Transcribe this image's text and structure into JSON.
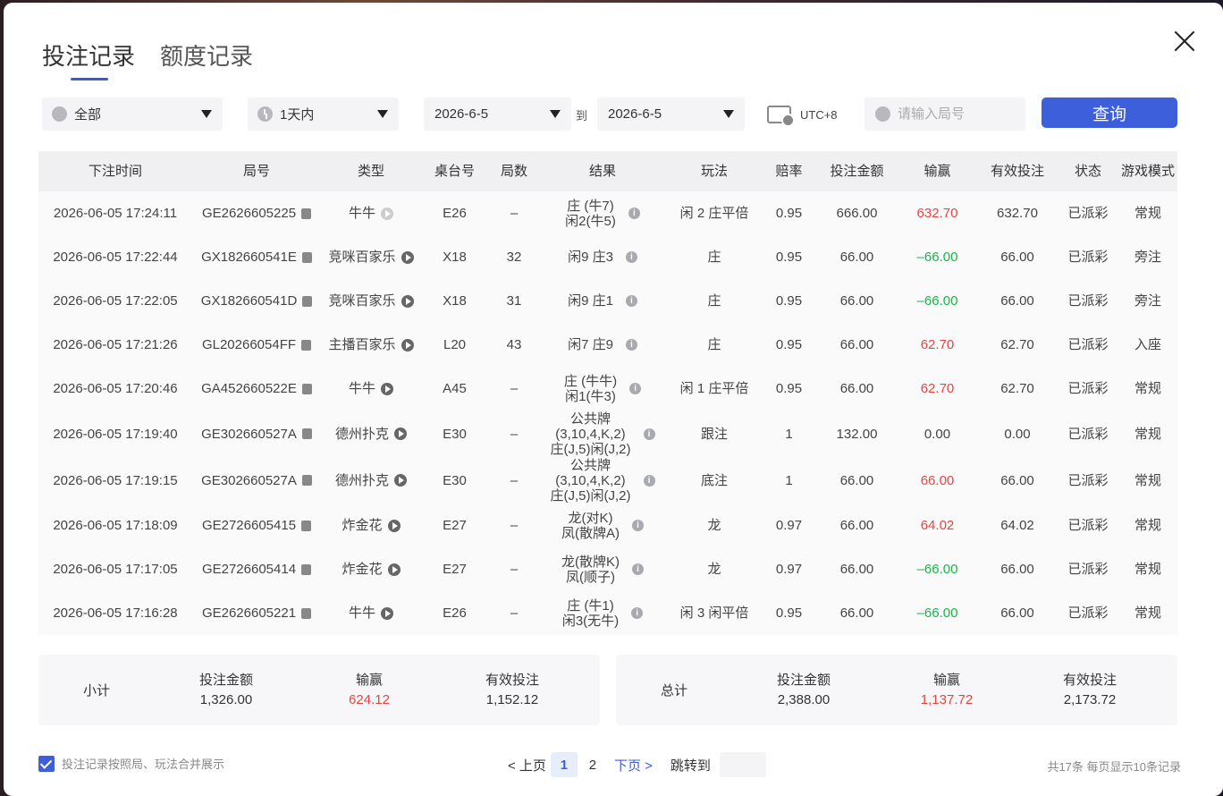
{
  "tabs": [
    {
      "label": "投注记录",
      "active": true
    },
    {
      "label": "额度记录",
      "active": false
    }
  ],
  "filters": {
    "category": "全部",
    "period": "1天内",
    "date_from": "2026-6-5",
    "to_label": "到",
    "date_to": "2026-6-5",
    "timezone": "UTC+8",
    "round_placeholder": "请输入局号",
    "query_label": "查询"
  },
  "columns": [
    "下注时间",
    "局号",
    "类型",
    "桌台号",
    "局数",
    "结果",
    "玩法",
    "赔率",
    "投注金额",
    "输赢",
    "有效投注",
    "状态",
    "游戏模式"
  ],
  "rows": [
    {
      "time": "2026-06-05 17:24:11",
      "round": "GE2626605225",
      "type": "牛牛",
      "table": "E26",
      "count": "–",
      "result1": "庄 (牛7)",
      "result2": "闲2(牛5)",
      "result3": "",
      "play": "闲 2 庄平倍",
      "odds": "0.95",
      "bet": "666.00",
      "win": "632.70",
      "win_color": "red",
      "valid": "632.70",
      "status": "已派彩",
      "mode": "常规"
    },
    {
      "time": "2026-06-05 17:22:44",
      "round": "GX182660541E",
      "type": "竞咪百家乐",
      "table": "X18",
      "count": "32",
      "result1": "闲9 庄3",
      "result2": "",
      "result3": "",
      "play": "庄",
      "odds": "0.95",
      "bet": "66.00",
      "win": "–66.00",
      "win_color": "green",
      "valid": "66.00",
      "status": "已派彩",
      "mode": "旁注"
    },
    {
      "time": "2026-06-05 17:22:05",
      "round": "GX182660541D",
      "type": "竞咪百家乐",
      "table": "X18",
      "count": "31",
      "result1": "闲9 庄1",
      "result2": "",
      "result3": "",
      "play": "庄",
      "odds": "0.95",
      "bet": "66.00",
      "win": "–66.00",
      "win_color": "green",
      "valid": "66.00",
      "status": "已派彩",
      "mode": "旁注"
    },
    {
      "time": "2026-06-05 17:21:26",
      "round": "GL20266054FF",
      "type": "主播百家乐",
      "table": "L20",
      "count": "43",
      "result1": "闲7 庄9",
      "result2": "",
      "result3": "",
      "play": "庄",
      "odds": "0.95",
      "bet": "66.00",
      "win": "62.70",
      "win_color": "red",
      "valid": "62.70",
      "status": "已派彩",
      "mode": "入座"
    },
    {
      "time": "2026-06-05 17:20:46",
      "round": "GA452660522E",
      "type": "牛牛",
      "table": "A45",
      "count": "–",
      "result1": "庄 (牛牛)",
      "result2": "闲1(牛3)",
      "result3": "",
      "play": "闲 1 庄平倍",
      "odds": "0.95",
      "bet": "66.00",
      "win": "62.70",
      "win_color": "red",
      "valid": "62.70",
      "status": "已派彩",
      "mode": "常规"
    },
    {
      "time": "2026-06-05 17:19:40",
      "round": "GE302660527A",
      "type": "德州扑克",
      "table": "E30",
      "count": "–",
      "result1": "公共牌",
      "result2": "(3,10,4,K,2)",
      "result3": "庄(J,5)闲(J,2)",
      "play": "跟注",
      "odds": "1",
      "bet": "132.00",
      "win": "0.00",
      "win_color": "",
      "valid": "0.00",
      "status": "已派彩",
      "mode": "常规"
    },
    {
      "time": "2026-06-05 17:19:15",
      "round": "GE302660527A",
      "type": "德州扑克",
      "table": "E30",
      "count": "–",
      "result1": "公共牌",
      "result2": "(3,10,4,K,2)",
      "result3": "庄(J,5)闲(J,2)",
      "play": "底注",
      "odds": "1",
      "bet": "66.00",
      "win": "66.00",
      "win_color": "red",
      "valid": "66.00",
      "status": "已派彩",
      "mode": "常规"
    },
    {
      "time": "2026-06-05 17:18:09",
      "round": "GE2726605415",
      "type": "炸金花",
      "table": "E27",
      "count": "–",
      "result1": "龙(对K)",
      "result2": "凤(散牌A)",
      "result3": "",
      "play": "龙",
      "odds": "0.97",
      "bet": "66.00",
      "win": "64.02",
      "win_color": "red",
      "valid": "64.02",
      "status": "已派彩",
      "mode": "常规"
    },
    {
      "time": "2026-06-05 17:17:05",
      "round": "GE2726605414",
      "type": "炸金花",
      "table": "E27",
      "count": "–",
      "result1": "龙(散牌K)",
      "result2": "凤(顺子)",
      "result3": "",
      "play": "龙",
      "odds": "0.97",
      "bet": "66.00",
      "win": "–66.00",
      "win_color": "green",
      "valid": "66.00",
      "status": "已派彩",
      "mode": "常规"
    },
    {
      "time": "2026-06-05 17:16:28",
      "round": "GE2626605221",
      "type": "牛牛",
      "table": "E26",
      "count": "–",
      "result1": "庄 (牛1)",
      "result2": "闲3(无牛)",
      "result3": "",
      "play": "闲 3 闲平倍",
      "odds": "0.95",
      "bet": "66.00",
      "win": "–66.00",
      "win_color": "green",
      "valid": "66.00",
      "status": "已派彩",
      "mode": "常规"
    }
  ],
  "subtotal": {
    "label": "小计",
    "bet_label": "投注金额",
    "bet": "1,326.00",
    "win_label": "输赢",
    "win": "624.12",
    "valid_label": "有效投注",
    "valid": "1,152.12"
  },
  "total": {
    "label": "总计",
    "bet_label": "投注金额",
    "bet": "2,388.00",
    "win_label": "输赢",
    "win": "1,137.72",
    "valid_label": "有效投注",
    "valid": "2,173.72"
  },
  "footer": {
    "merge_label": "投注记录按照局、玩法合并展示",
    "prev": "< 上页",
    "pages": [
      "1",
      "2"
    ],
    "current_page": "1",
    "next": "下页 >",
    "jump_label": "跳转到",
    "info": "共17条   每页显示10条记录"
  },
  "colors": {
    "accent": "#3d5fdb",
    "win_positive": "#e5463f",
    "win_negative": "#17b54a"
  }
}
